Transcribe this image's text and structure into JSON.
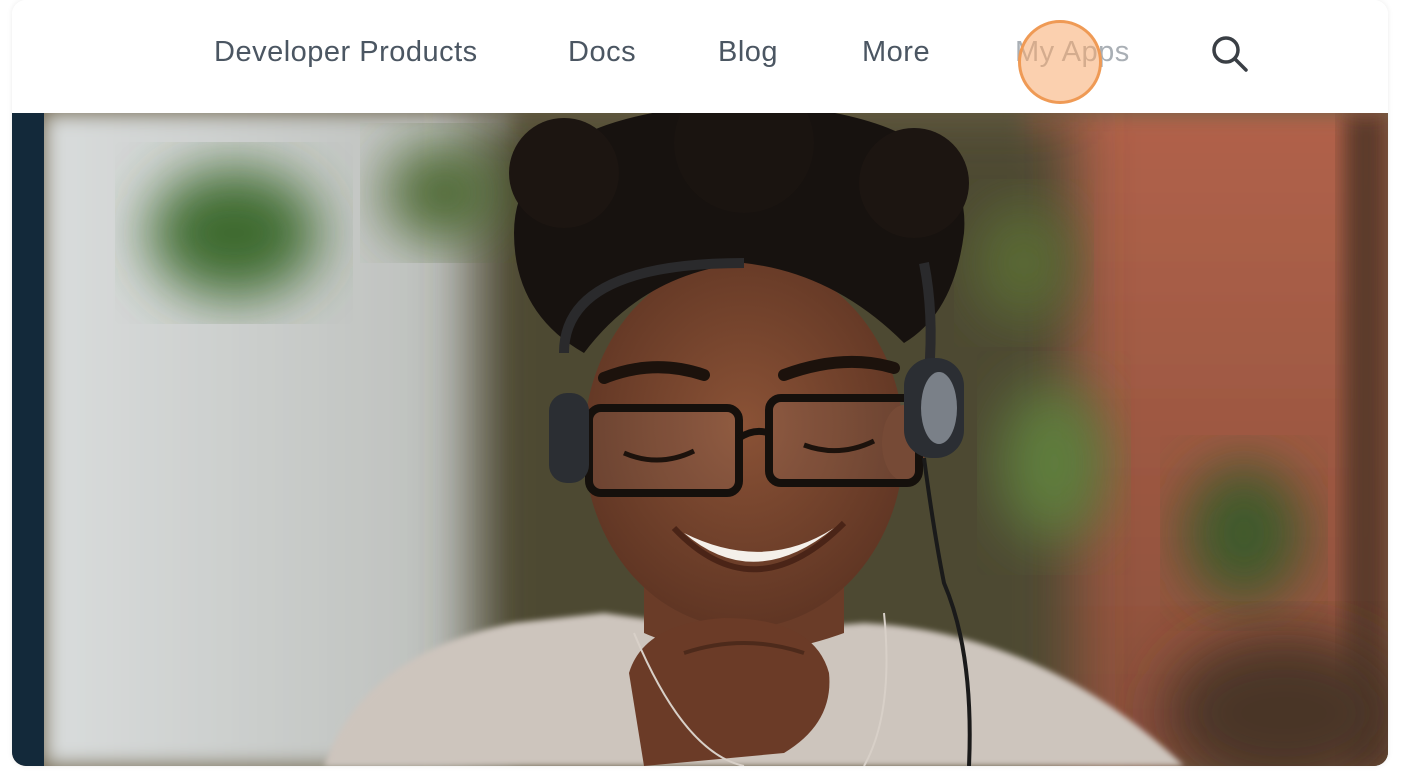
{
  "nav": {
    "items": [
      {
        "label": "Developer Products"
      },
      {
        "label": "Docs"
      },
      {
        "label": "Blog"
      },
      {
        "label": "More"
      },
      {
        "label": "My Apps"
      }
    ],
    "search_icon": "search-icon"
  },
  "hero": {
    "image": "woman-with-headset-smiling-photo"
  },
  "colors": {
    "nav_text": "#4b5662",
    "nav_text_muted": "#a9afb5",
    "click_marker": "#ef9a55",
    "hero_stripe": "#13293a"
  }
}
